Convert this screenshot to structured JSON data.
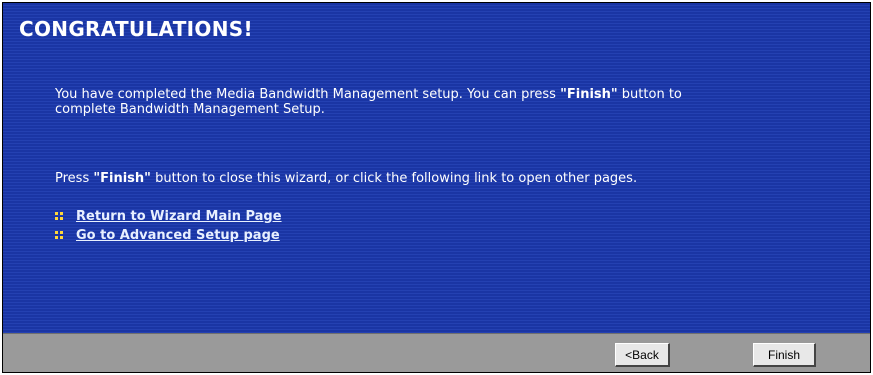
{
  "wizard": {
    "title": "CONGRATULATIONS!",
    "paragraph1": {
      "prefix": "You have completed the Media Bandwidth Management setup. You can press ",
      "bold": "\"Finish\"",
      "suffix_line1": " button to",
      "line2": "complete Bandwidth Management Setup."
    },
    "paragraph2": {
      "prefix": "Press ",
      "bold": "\"Finish\"",
      "suffix": " button to close this wizard, or click the following link to open other pages."
    },
    "links": [
      {
        "label": "Return to Wizard Main Page",
        "icon": "bullet-dots-icon"
      },
      {
        "label": "Go to Advanced Setup page",
        "icon": "bullet-dots-icon"
      }
    ]
  },
  "buttons": {
    "back_label": "<Back",
    "finish_label": "Finish"
  },
  "colors": {
    "panel_background": "#1b37a8",
    "text": "#ffffff",
    "bullet": "#ffd83a",
    "button_bar": "#9a9a9a"
  }
}
